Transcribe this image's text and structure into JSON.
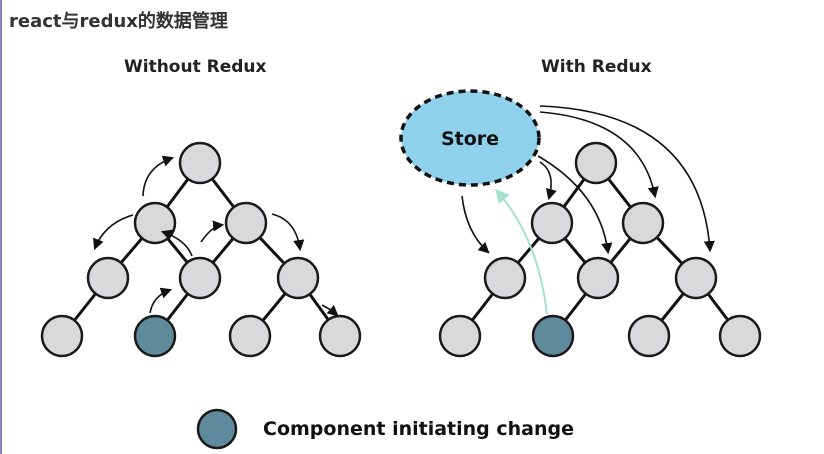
{
  "page": {
    "title": "react与redux的数据管理"
  },
  "panels": {
    "without": {
      "title": "Without Redux"
    },
    "with": {
      "title": "With Redux",
      "store_label": "Store"
    }
  },
  "legend": {
    "label": "Component initiating change"
  },
  "colors": {
    "node_fill": "#d9d9db",
    "node_stroke": "#1a1a1a",
    "initiator_fill": "#5f8a9c",
    "store_fill": "#8fd0ec",
    "store_arrow": "#a6e0cf",
    "edge": "#111111"
  }
}
